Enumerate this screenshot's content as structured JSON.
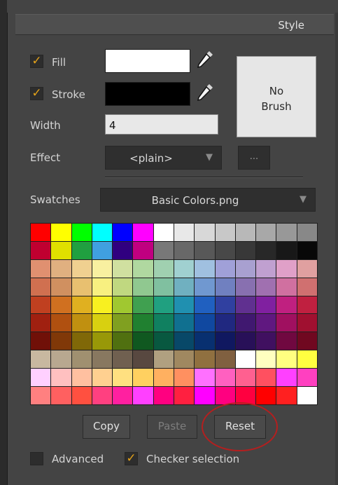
{
  "header": {
    "title": "Style"
  },
  "fill": {
    "label": "Fill",
    "checked": true,
    "color": "#ffffff"
  },
  "stroke": {
    "label": "Stroke",
    "checked": true,
    "color": "#000000"
  },
  "brush_preview": {
    "line1": "No",
    "line2": "Brush"
  },
  "width": {
    "label": "Width",
    "value": "4"
  },
  "effect": {
    "label": "Effect",
    "value": "<plain>",
    "more_label": "..."
  },
  "swatches": {
    "label": "Swatches",
    "file": "Basic Colors.png",
    "grid": [
      [
        "#ff0000",
        "#ffff00",
        "#00ff00",
        "#00ffff",
        "#0000ff",
        "#ff00ff",
        "#ffffff",
        "#e8e8e8",
        "#d8d8d8",
        "#c8c8c8",
        "#b8b8b8",
        "#a8a8a8",
        "#989898",
        "#888888"
      ],
      [
        "#c00030",
        "#e0e000",
        "#20a040",
        "#40a0e0",
        "#300080",
        "#c00080",
        "#787878",
        "#686868",
        "#585858",
        "#484848",
        "#383838",
        "#282828",
        "#181818",
        "#080808"
      ],
      [
        "#e09070",
        "#e0b080",
        "#f0d090",
        "#f8f0a0",
        "#d0e0a0",
        "#b0d8a0",
        "#a0d0b0",
        "#a0d0d0",
        "#a0c0e0",
        "#a0a0d8",
        "#a8a0d0",
        "#c0a0d0",
        "#e0a0c8",
        "#e0a0a0"
      ],
      [
        "#d07050",
        "#d09060",
        "#e8c070",
        "#f8f080",
        "#c0d880",
        "#90c890",
        "#80c0a0",
        "#70b0c0",
        "#7098d0",
        "#7080c0",
        "#8870b0",
        "#a070b0",
        "#d070a0",
        "#d07070"
      ],
      [
        "#c04020",
        "#d07020",
        "#e0b020",
        "#f8f020",
        "#a0c830",
        "#40a050",
        "#20a080",
        "#2090b0",
        "#2060c0",
        "#3040a0",
        "#603090",
        "#8020a0",
        "#c02080",
        "#c02040"
      ],
      [
        "#a02010",
        "#b05010",
        "#c09010",
        "#d8d010",
        "#80a020",
        "#208030",
        "#108060",
        "#107090",
        "#1048a0",
        "#202880",
        "#401870",
        "#601880",
        "#a01060",
        "#a01030"
      ],
      [
        "#701008",
        "#803808",
        "#806808",
        "#989808",
        "#507010",
        "#105820",
        "#085840",
        "#084868",
        "#083070",
        "#101860",
        "#281058",
        "#401060",
        "#700840",
        "#700820"
      ],
      [
        "#c8b8a0",
        "#b8a890",
        "#a09070",
        "#887860",
        "#706050",
        "#584840",
        "#b0a080",
        "#a08860",
        "#907040",
        "#806040",
        "#ffffff",
        "#ffffc0",
        "#ffff80",
        "#ffff40"
      ],
      [
        "#ffd0ff",
        "#ffc0c0",
        "#ffc0a0",
        "#ffd090",
        "#ffe080",
        "#ffd060",
        "#ffb060",
        "#ff9060",
        "#ff70ff",
        "#ff60c0",
        "#ff6090",
        "#ff5060",
        "#ff40ff",
        "#ff40c0"
      ],
      [
        "#ff8080",
        "#ff6060",
        "#ff5040",
        "#ff4080",
        "#ff20a0",
        "#ff40ff",
        "#ff0080",
        "#ff2040",
        "#ff00ff",
        "#ff0080",
        "#ff0040",
        "#ff0000",
        "#ff2020",
        "#ffffff"
      ]
    ]
  },
  "buttons": {
    "copy": "Copy",
    "paste": "Paste",
    "reset": "Reset"
  },
  "options": {
    "advanced": {
      "label": "Advanced",
      "checked": false
    },
    "checker": {
      "label": "Checker selection",
      "checked": true
    }
  },
  "colors": {
    "accent": "#e3a21a",
    "highlight_ring": "#b41f1f"
  }
}
